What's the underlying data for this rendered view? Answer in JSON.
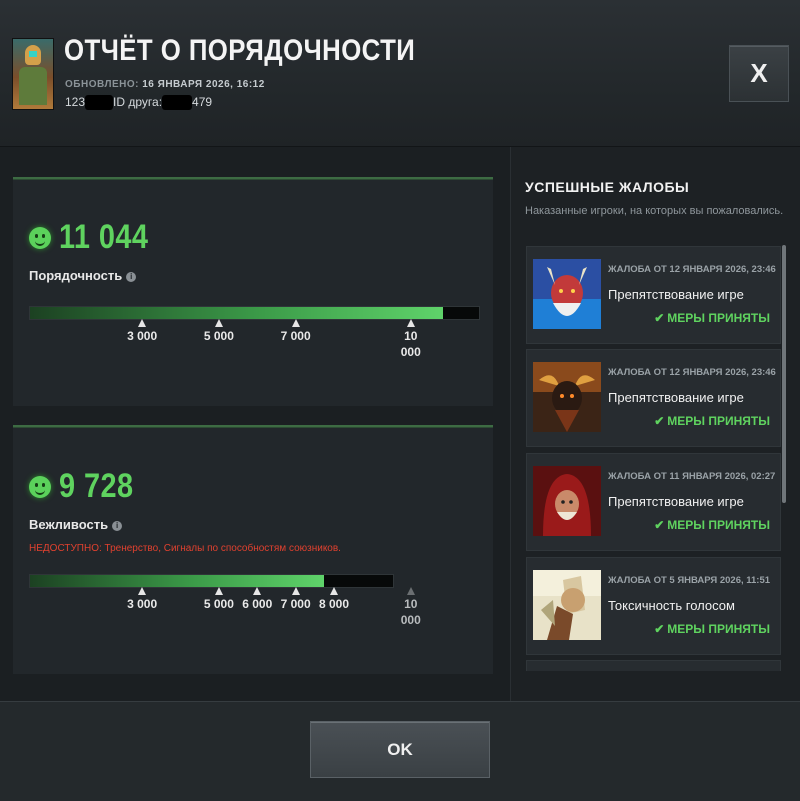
{
  "header": {
    "title": "ОТЧЁТ О ПОРЯДОЧНОСТИ",
    "updated_label": "ОБНОВЛЕНО:",
    "updated_value": "16 ЯНВАРЯ 2026, 16:12",
    "account_id_prefix": "123",
    "friend_id_label": "ID друга:",
    "friend_id_suffix": "479",
    "close_label": "X"
  },
  "conduct": {
    "score": "11 044",
    "label": "Порядочность",
    "fill_fraction": 0.92,
    "ticks": [
      {
        "label": "3 000",
        "value": 3000
      },
      {
        "label": "5 000",
        "value": 5000
      },
      {
        "label": "7 000",
        "value": 7000
      },
      {
        "label": "10\n000",
        "value": 10000
      }
    ]
  },
  "behavior": {
    "score": "9 728",
    "label": "Вежливость",
    "unavailable": "НЕДОСТУПНО: Тренерство, Сигналы по способностям союзников.",
    "fill_fraction": 0.81,
    "ticks": [
      {
        "label": "3 000",
        "value": 3000
      },
      {
        "label": "5 000",
        "value": 5000
      },
      {
        "label": "6 000",
        "value": 6000
      },
      {
        "label": "7 000",
        "value": 7000
      },
      {
        "label": "8 000",
        "value": 8000
      },
      {
        "label": "10\n000",
        "value": 10000,
        "locked": true
      }
    ]
  },
  "reports": {
    "title": "УСПЕШНЫЕ ЖАЛОБЫ",
    "subtitle": "Наказанные игроки, на которых вы пожаловались.",
    "items": [
      {
        "date": "ЖАЛОБА ОТ 12 ЯНВАРЯ 2026, 23:46",
        "reason": "Препятствование игре",
        "status": "МЕРЫ ПРИНЯТЫ",
        "hero_icon": "hero-portrait-red-horned"
      },
      {
        "date": "ЖАЛОБА ОТ 12 ЯНВАРЯ 2026, 23:46",
        "reason": "Препятствование игре",
        "status": "МЕРЫ ПРИНЯТЫ",
        "hero_icon": "hero-portrait-dark-horned"
      },
      {
        "date": "ЖАЛОБА ОТ 11 ЯНВАРЯ 2026, 02:27",
        "reason": "Препятствование игре",
        "status": "МЕРЫ ПРИНЯТЫ",
        "hero_icon": "hero-portrait-hooded"
      },
      {
        "date": "ЖАЛОБА ОТ 5 ЯНВАРЯ 2026, 11:51",
        "reason": "Токсичность голосом",
        "status": "МЕРЫ ПРИНЯТЫ",
        "hero_icon": "hero-portrait-light"
      }
    ]
  },
  "footer": {
    "ok_label": "OK"
  },
  "colors": {
    "accent_green": "#5fd35f",
    "warning_red": "#e0412f"
  }
}
